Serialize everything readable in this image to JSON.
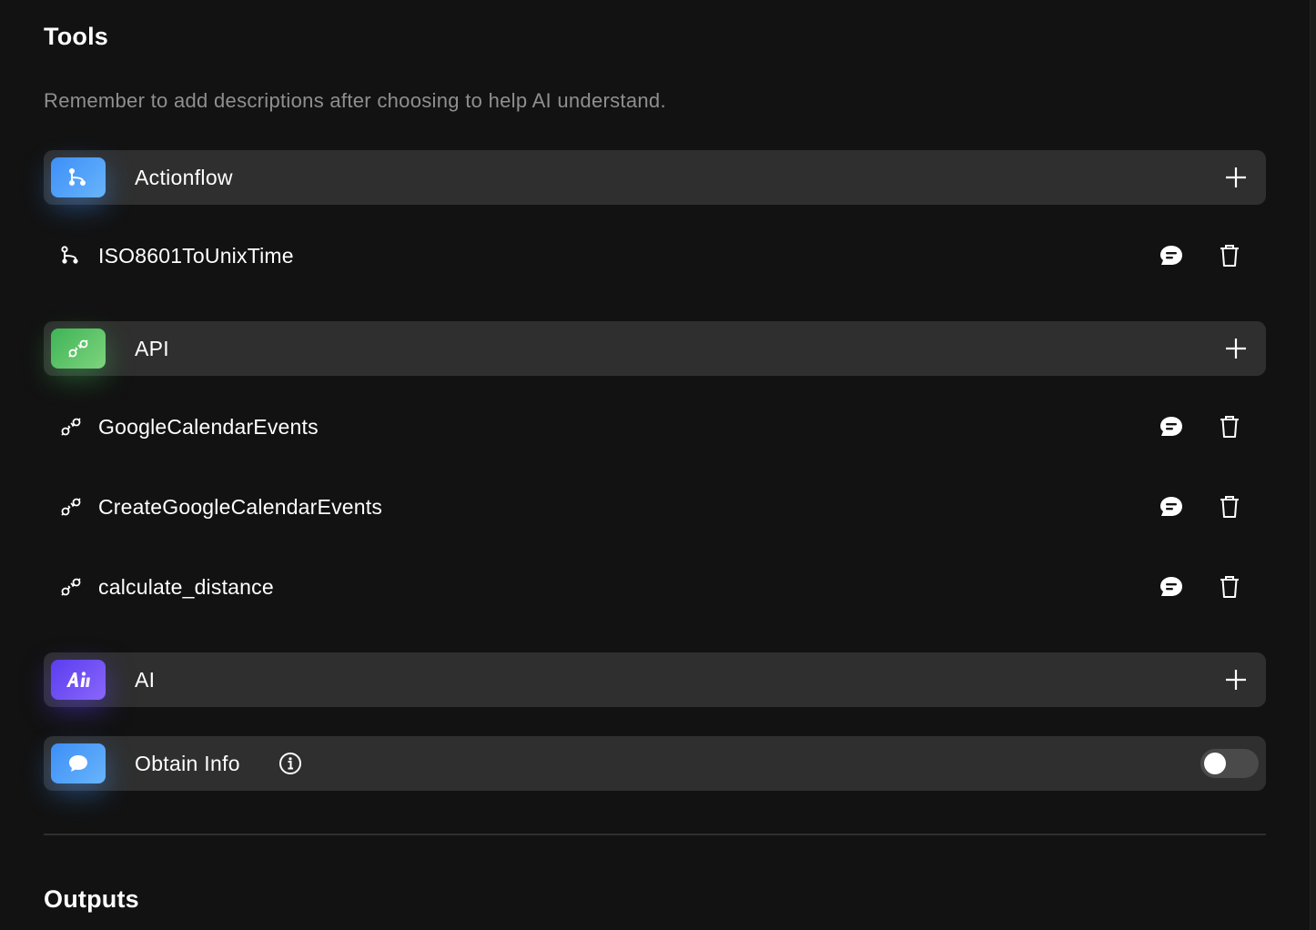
{
  "tools_section": {
    "title": "Tools",
    "hint": "Remember to add descriptions after choosing to help AI understand."
  },
  "groups": {
    "actionflow": {
      "label": "Actionflow",
      "icon": "actionflow-icon",
      "color": "#3d8ff7",
      "items": [
        {
          "label": "ISO8601ToUnixTime",
          "icon": "actionflow-icon"
        }
      ]
    },
    "api": {
      "label": "API",
      "icon": "api-plug-icon",
      "color": "#3fb356",
      "items": [
        {
          "label": "GoogleCalendarEvents",
          "icon": "api-plug-icon"
        },
        {
          "label": "CreateGoogleCalendarEvents",
          "icon": "api-plug-icon"
        },
        {
          "label": "calculate_distance",
          "icon": "api-plug-icon"
        }
      ]
    },
    "ai": {
      "label": "AI",
      "icon": "ai-icon",
      "color": "#5a3df0"
    },
    "obtain_info": {
      "label": "Obtain Info",
      "icon": "chat-bubble-icon",
      "color": "#3d8ff7",
      "toggle_on": false
    }
  },
  "outputs_section": {
    "title": "Outputs"
  }
}
